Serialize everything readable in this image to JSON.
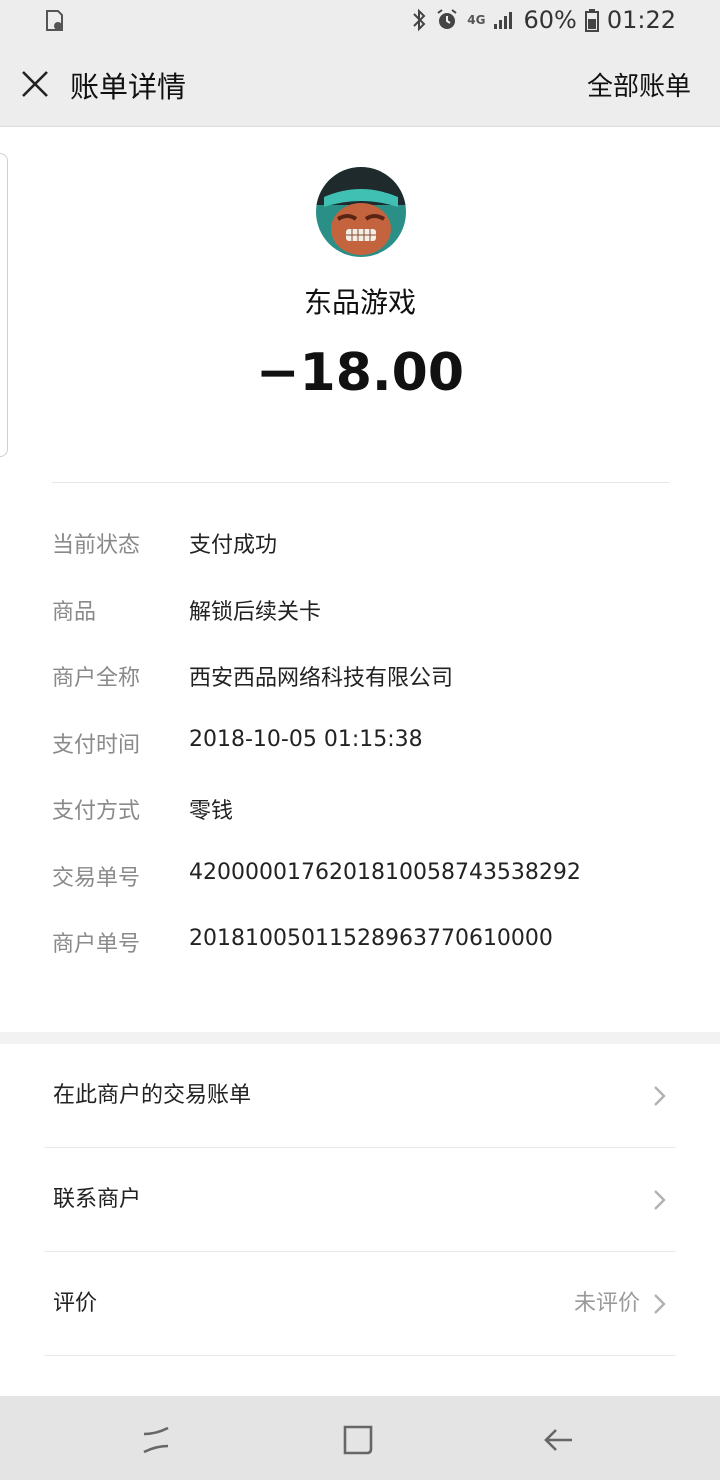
{
  "status_bar": {
    "network": "4G",
    "battery": "60%",
    "time": "01:22"
  },
  "header": {
    "title": "账单详情",
    "action_label": "全部账单"
  },
  "merchant": {
    "name": "东品游戏",
    "amount": "−18.00"
  },
  "details": [
    {
      "label": "当前状态",
      "value": "支付成功"
    },
    {
      "label": "商品",
      "value": "解锁后续关卡"
    },
    {
      "label": "商户全称",
      "value": "西安西品网络科技有限公司"
    },
    {
      "label": "支付时间",
      "value": "2018-10-05 01:15:38"
    },
    {
      "label": "支付方式",
      "value": "零钱"
    },
    {
      "label": "交易单号",
      "value": "4200000176201810058743538292"
    },
    {
      "label": "商户单号",
      "value": "20181005011528963770610000"
    }
  ],
  "menu": [
    {
      "label": "在此商户的交易账单",
      "value": ""
    },
    {
      "label": "联系商户",
      "value": ""
    },
    {
      "label": "评价",
      "value": "未评价"
    }
  ],
  "colors": {
    "header_bg": "#ededed",
    "label_gray": "#8a8a8a",
    "text_dark": "#111111"
  }
}
